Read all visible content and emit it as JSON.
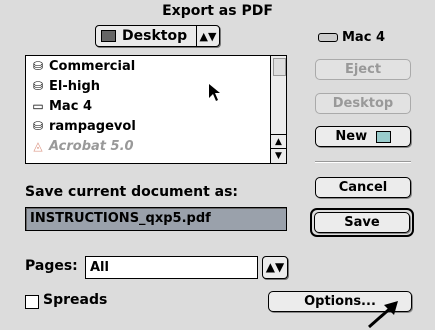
{
  "dialog": {
    "title": "Export as PDF"
  },
  "location": {
    "popup_label": "Desktop",
    "disk_name": "Mac 4"
  },
  "file_list": [
    {
      "label": "Commercial",
      "icon": "server-icon",
      "enabled": true
    },
    {
      "label": "El-high",
      "icon": "server-icon",
      "enabled": true
    },
    {
      "label": "Mac 4",
      "icon": "drive-icon",
      "enabled": true
    },
    {
      "label": "rampagevol",
      "icon": "server-icon",
      "enabled": true
    },
    {
      "label": "Acrobat 5.0",
      "icon": "acrobat-icon",
      "enabled": false
    }
  ],
  "buttons": {
    "eject": "Eject",
    "desktop": "Desktop",
    "new": "New",
    "cancel": "Cancel",
    "save": "Save",
    "options": "Options..."
  },
  "save_as": {
    "label": "Save current document as:",
    "value": "INSTRUCTIONS_qxp5.pdf"
  },
  "pages": {
    "label": "Pages:",
    "value": "All"
  },
  "spreads": {
    "label": "Spreads",
    "checked": false
  }
}
